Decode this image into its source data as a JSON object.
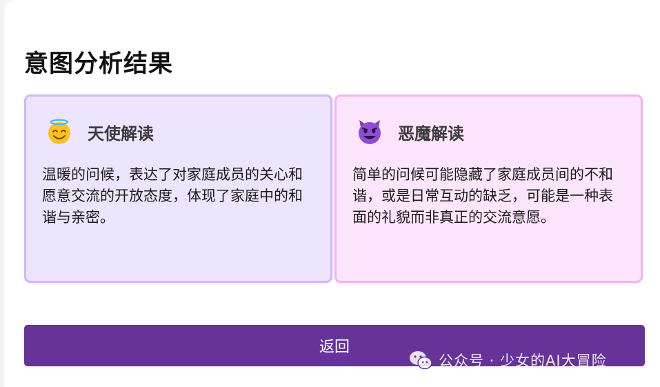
{
  "page": {
    "title": "意图分析结果"
  },
  "angel": {
    "icon": "halo-smile-emoji-icon",
    "title": "天使解读",
    "text": "温暖的问候，表达了对家庭成员的关心和愿意交流的开放态度，体现了家庭中的和谐与亲密。"
  },
  "devil": {
    "icon": "smiling-devil-emoji-icon",
    "title": "恶魔解读",
    "text": "简单的问候可能隐藏了家庭成员间的不和谐，或是日常互动的缺乏，可能是一种表面的礼貌而非真正的交流意愿。"
  },
  "actions": {
    "back_label": "返回"
  },
  "watermark": {
    "icon": "wechat-icon",
    "text": "公众号 · 少女的AI大冒险"
  },
  "colors": {
    "accent": "#663399",
    "angel_bg": "#ede4fd",
    "angel_border": "#d4b6f8",
    "devil_bg": "#fde6fd",
    "devil_border": "#f3b3ef"
  }
}
